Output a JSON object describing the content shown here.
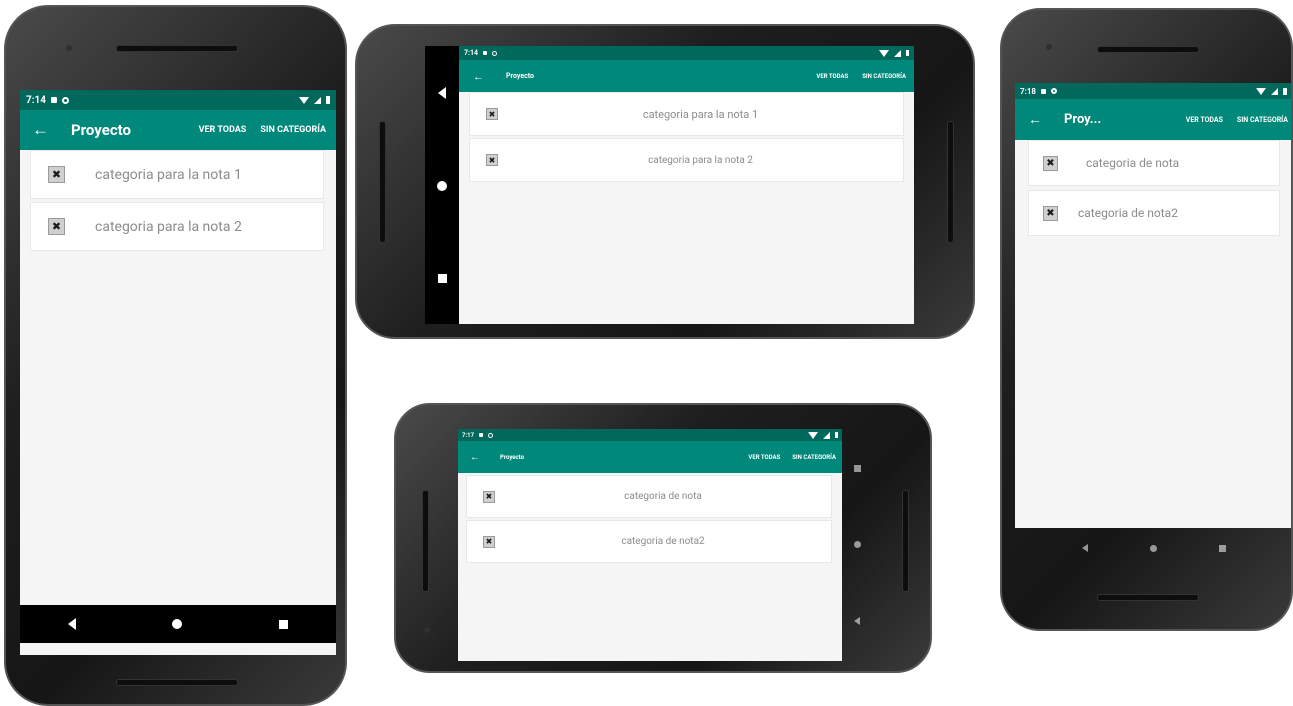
{
  "screens": [
    {
      "time": "7:14",
      "title": "Proyecto",
      "actions": [
        "VER TODAS",
        "SIN CATEGORÍA"
      ],
      "items": [
        "categoria para la nota 1",
        "categoria para la nota 2"
      ]
    },
    {
      "time": "7:14",
      "title": "Proyecto",
      "actions": [
        "VER TODAS",
        "SIN CATEGORÍA"
      ],
      "items": [
        "categoria para la nota 1",
        "categoria para la nota 2"
      ]
    },
    {
      "time": "7:17",
      "title": "Proyecto",
      "actions": [
        "VER TODAS",
        "SIN CATEGORÍA"
      ],
      "items": [
        "categoria de nota",
        "categoria de nota2"
      ]
    },
    {
      "time": "7:18",
      "title": "Proy...",
      "actions": [
        "VER TODAS",
        "SIN CATEGORÍA"
      ],
      "items": [
        "categoria de nota",
        "categoria de nota2"
      ]
    }
  ],
  "icons": {
    "back": "←",
    "delete": "✖"
  },
  "colors": {
    "status_bar": "#00695c",
    "app_bar": "#00897b",
    "screen_background": "#f5f5f5",
    "item_text": "#8c8c8c"
  }
}
